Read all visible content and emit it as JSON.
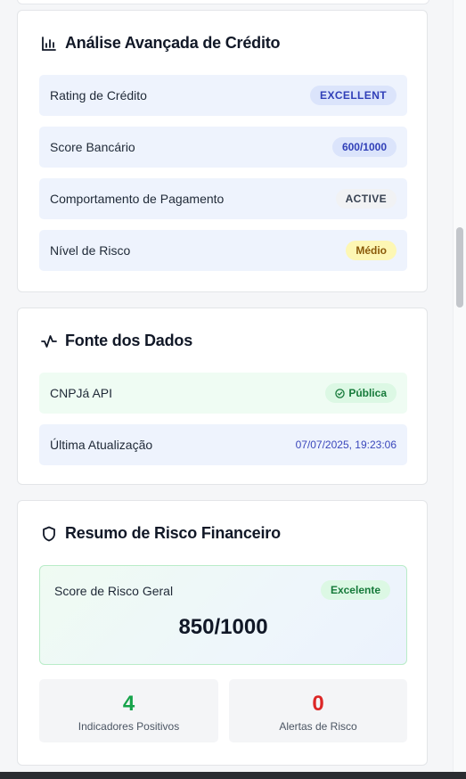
{
  "credit_card": {
    "title": "Análise Avançada de Crédito",
    "icon": "bar-chart-icon",
    "rows": [
      {
        "label": "Rating de Crédito",
        "badge": "EXCELLENT"
      },
      {
        "label": "Score Bancário",
        "badge": "600/1000"
      },
      {
        "label": "Comportamento de Pagamento",
        "badge": "ACTIVE"
      },
      {
        "label": "Nível de Risco",
        "badge": "Médio"
      }
    ]
  },
  "source_card": {
    "title": "Fonte dos Dados",
    "icon": "activity-icon",
    "api_label": "CNPJá API",
    "api_badge": "Pública",
    "updated_label": "Última Atualização",
    "updated_value": "07/07/2025, 19:23:06"
  },
  "risk_card": {
    "title": "Resumo de Risco Financeiro",
    "icon": "shield-icon",
    "score_label": "Score de Risco Geral",
    "score_badge": "Excelente",
    "score_value": "850/1000",
    "positive_count": "4",
    "positive_label": "Indicadores Positivos",
    "alerts_count": "0",
    "alerts_label": "Alertas de Risco"
  },
  "colors": {
    "positive": "#16a34a",
    "alert": "#dc2626",
    "accent": "#3140b8"
  }
}
